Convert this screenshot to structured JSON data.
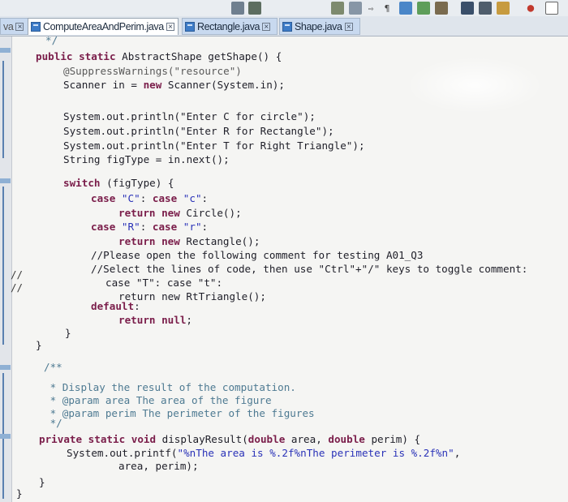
{
  "tabs": [
    {
      "label": "ComputeAreaAndPerim.java",
      "active": true
    },
    {
      "label": "Rectangle.java",
      "active": false
    },
    {
      "label": "Shape.java",
      "active": false
    }
  ],
  "left_cut_tab": "va",
  "comment_prefixes": [
    "//",
    "//"
  ],
  "code": {
    "l1": "*/",
    "l2_kw": "public static",
    "l2_rest": " AbstractShape getShape() {",
    "l3": "@SuppressWarnings(\"resource\")",
    "l4a": "Scanner in = ",
    "l4_kw": "new",
    "l4b": " Scanner(System.in);",
    "l5": "System.out.println(\"Enter C for circle\");",
    "l6": "System.out.println(\"Enter R for Rectangle\");",
    "l7": "System.out.println(\"Enter T for Right Triangle\");",
    "l8": "String figType = in.next();",
    "l9_kw": "switch",
    "l9_rest": " (figType) {",
    "l10_kw1": "case",
    "l10_s1": " \"C\"",
    "l10_mid": ": ",
    "l10_kw2": "case",
    "l10_s2": " \"c\"",
    "l10_end": ":",
    "l11_kw": "return new",
    "l11_rest": " Circle();",
    "l12_kw1": "case",
    "l12_s1": " \"R\"",
    "l12_mid": ": ",
    "l12_kw2": "case",
    "l12_s2": " \"r\"",
    "l12_end": ":",
    "l13_kw": "return new",
    "l13_rest": " Rectangle();",
    "l14": "//Please open the following comment for testing A01_Q3",
    "l15": "//Select the lines of code, then use \"Ctrl\"+\"/\" keys to toggle comment:",
    "l16": "case \"T\": case \"t\":",
    "l17": "return new RtTriangle();",
    "l18_kw": "default",
    "l18_end": ":",
    "l19_kw": "return null",
    "l19_end": ";",
    "l20": "}",
    "l21": "}",
    "l22": "/**",
    "l23": " * Display the result of the computation.",
    "l24": " * @param area The area of the figure",
    "l25": " * @param perim The perimeter of the figures",
    "l26": " */",
    "l27_kw": "private static void",
    "l27_rest": " displayResult(",
    "l27_t1": "double",
    "l27_p1": " area, ",
    "l27_t2": "double",
    "l27_p2": " perim) {",
    "l28a": "System.out.printf(",
    "l28_s": "\"%nThe area is %.2f%nThe perimeter is %.2f%n\"",
    "l28b": ",",
    "l29": "area, perim);",
    "l30": "}",
    "l31": "}"
  }
}
